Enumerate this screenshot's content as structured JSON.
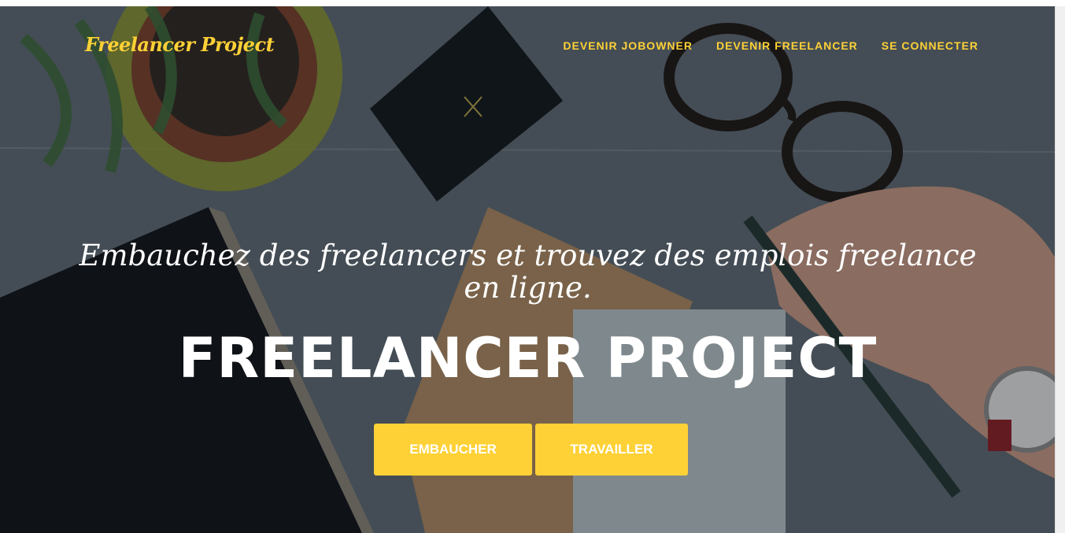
{
  "nav": {
    "brand": "Freelancer Project",
    "links": [
      {
        "label": "DEVENIR JOBOWNER"
      },
      {
        "label": "DEVENIR FREELANCER"
      },
      {
        "label": "SE CONNECTER"
      }
    ]
  },
  "hero": {
    "lead_line1": "Embauchez des freelancers et trouvez des emplois freelance",
    "lead_line2": "en ligne.",
    "heading": "FREELANCER PROJECT",
    "buttons": {
      "hire": "EMBAUCHER",
      "work": "TRAVAILLER"
    }
  },
  "colors": {
    "accent": "#fed136",
    "text": "#ffffff"
  }
}
